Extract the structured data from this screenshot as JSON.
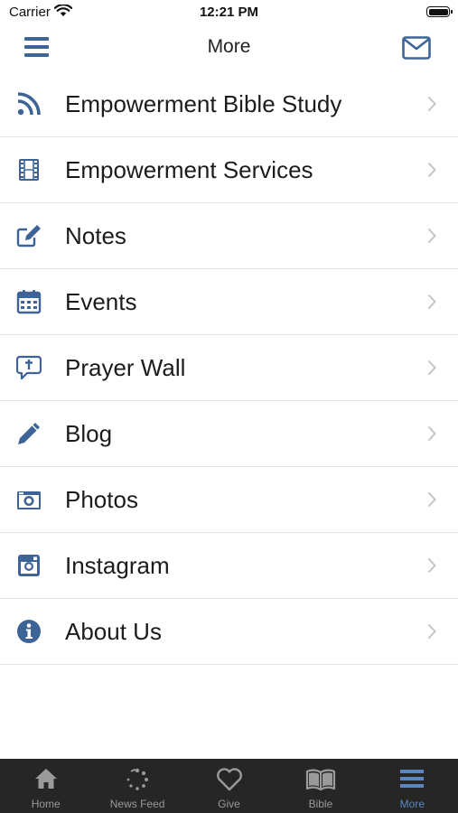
{
  "status_bar": {
    "carrier": "Carrier",
    "time": "12:21 PM"
  },
  "nav": {
    "title": "More",
    "left_icon": "hamburger-menu-icon",
    "right_icon": "mail-icon"
  },
  "accent_color": "#3d6397",
  "menu": [
    {
      "label": "Empowerment Bible Study",
      "icon": "rss-icon"
    },
    {
      "label": "Empowerment Services",
      "icon": "film-icon"
    },
    {
      "label": "Notes",
      "icon": "edit-note-icon"
    },
    {
      "label": "Events",
      "icon": "calendar-icon"
    },
    {
      "label": "Prayer Wall",
      "icon": "prayer-wall-icon"
    },
    {
      "label": "Blog",
      "icon": "pencil-icon"
    },
    {
      "label": "Photos",
      "icon": "camera-icon"
    },
    {
      "label": "Instagram",
      "icon": "instagram-icon"
    },
    {
      "label": "About Us",
      "icon": "info-icon"
    }
  ],
  "tabs": [
    {
      "label": "Home",
      "icon": "home-icon",
      "active": false
    },
    {
      "label": "News Feed",
      "icon": "news-feed-icon",
      "active": false
    },
    {
      "label": "Give",
      "icon": "heart-icon",
      "active": false
    },
    {
      "label": "Bible",
      "icon": "book-icon",
      "active": false
    },
    {
      "label": "More",
      "icon": "hamburger-icon",
      "active": true
    }
  ]
}
